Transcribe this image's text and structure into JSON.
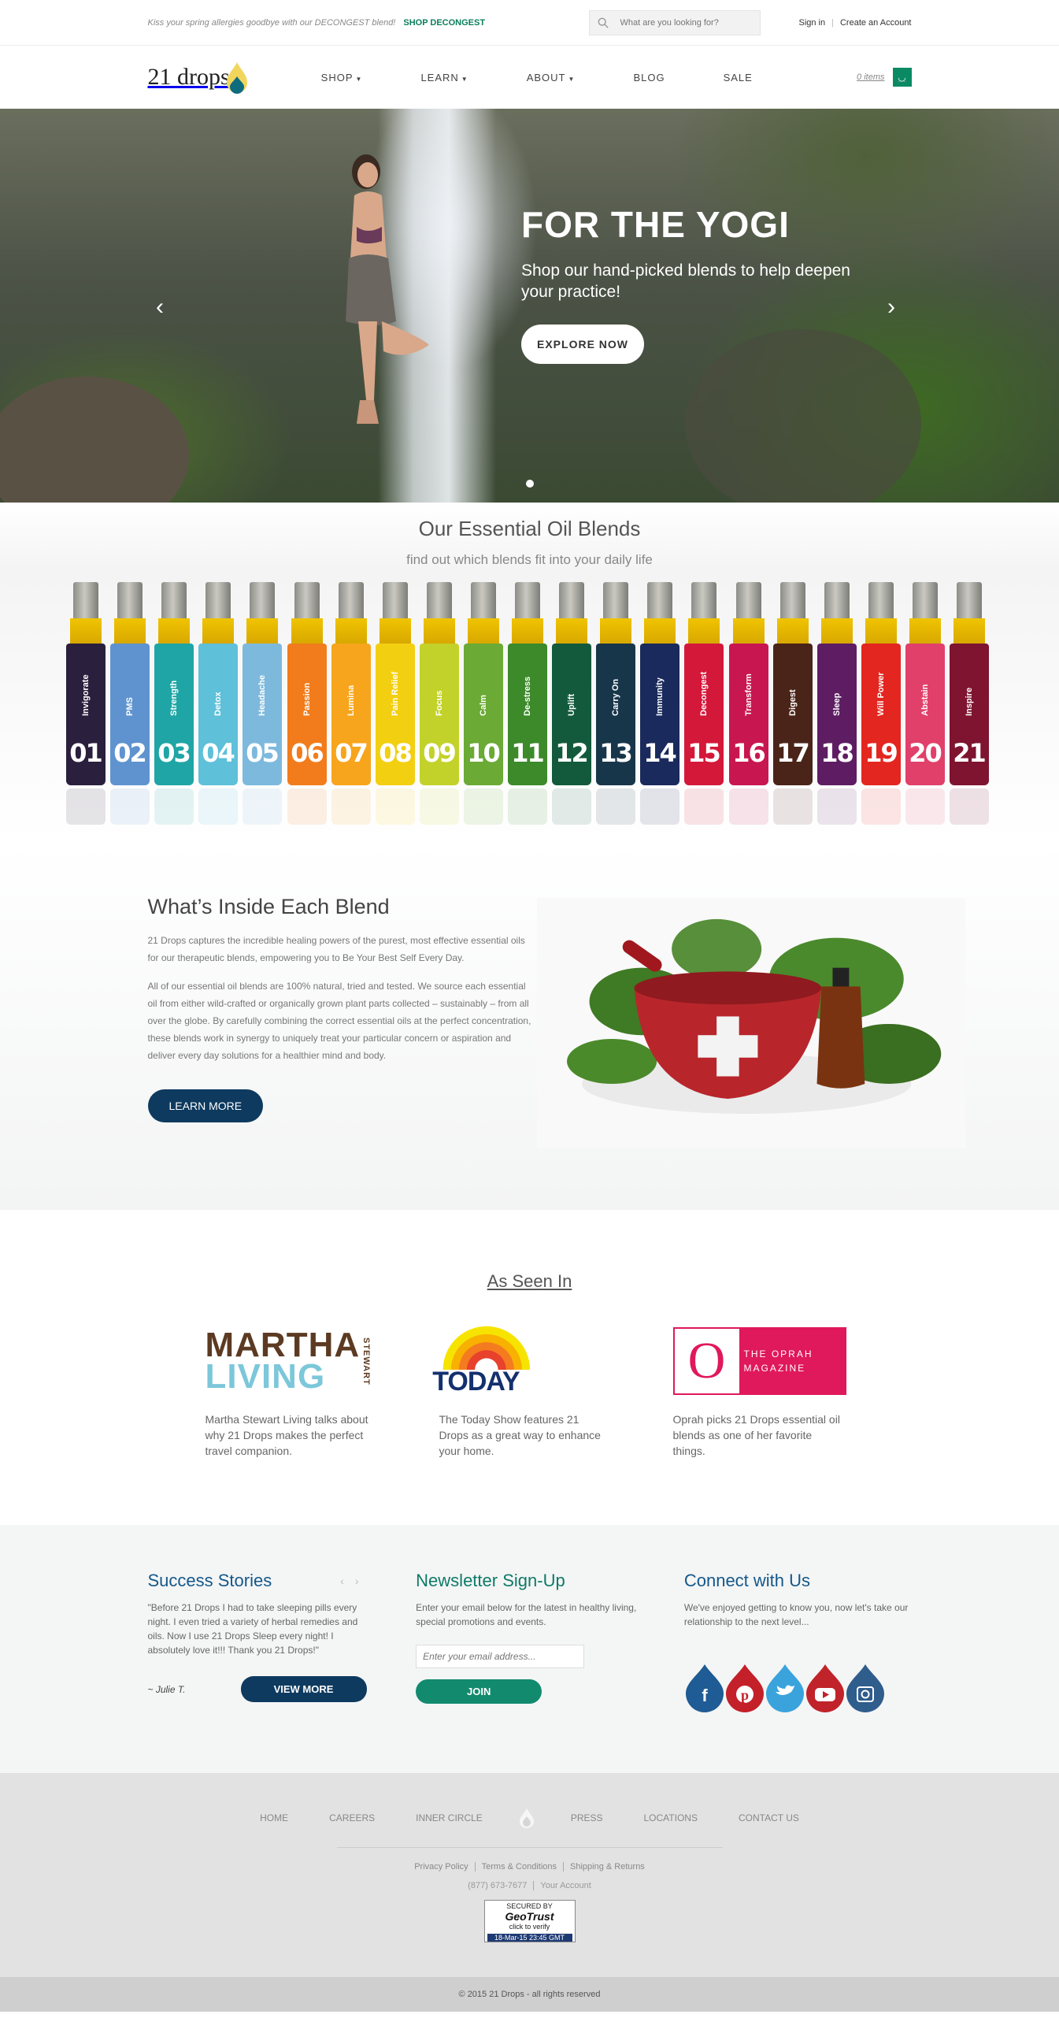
{
  "topbar": {
    "promo_text": "Kiss your spring allergies goodbye with our DECONGEST blend!",
    "promo_link": "SHOP DECONGEST",
    "search_placeholder": "What are you looking for?",
    "signin": "Sign in",
    "create_account": "Create an Account"
  },
  "nav": {
    "logo": "21 drops",
    "items": [
      "SHOP",
      "LEARN",
      "ABOUT",
      "BLOG",
      "SALE"
    ],
    "cart": "0 items"
  },
  "hero": {
    "title": "FOR THE YOGI",
    "subtitle": "Shop our hand-picked blends to help deepen your practice!",
    "button": "EXPLORE NOW"
  },
  "blends": {
    "title": "Our Essential Oil Blends",
    "subtitle": "find out which blends fit into your daily life",
    "items": [
      {
        "num": "01",
        "name": "Invigorate",
        "color": "#2a1f3d"
      },
      {
        "num": "02",
        "name": "PMS",
        "color": "#5f93cf"
      },
      {
        "num": "03",
        "name": "Strength",
        "color": "#1fa5a5"
      },
      {
        "num": "04",
        "name": "Detox",
        "color": "#5ec0d9"
      },
      {
        "num": "05",
        "name": "Headache",
        "color": "#7db9dd"
      },
      {
        "num": "06",
        "name": "Passion",
        "color": "#f27c1b"
      },
      {
        "num": "07",
        "name": "Lumina",
        "color": "#f7a51d"
      },
      {
        "num": "08",
        "name": "Pain Relief",
        "color": "#f3cf12"
      },
      {
        "num": "09",
        "name": "Focus",
        "color": "#c3d22a"
      },
      {
        "num": "10",
        "name": "Calm",
        "color": "#6aaa35"
      },
      {
        "num": "11",
        "name": "De-stress",
        "color": "#3c8a2a"
      },
      {
        "num": "12",
        "name": "Uplift",
        "color": "#135a3c"
      },
      {
        "num": "13",
        "name": "Carry On",
        "color": "#18364a"
      },
      {
        "num": "14",
        "name": "Immunity",
        "color": "#1a2a5c"
      },
      {
        "num": "15",
        "name": "Decongest",
        "color": "#d4183a"
      },
      {
        "num": "16",
        "name": "Transform",
        "color": "#c81650"
      },
      {
        "num": "17",
        "name": "Digest",
        "color": "#4a2418"
      },
      {
        "num": "18",
        "name": "Sleep",
        "color": "#5e1d63"
      },
      {
        "num": "19",
        "name": "Will Power",
        "color": "#e3261f"
      },
      {
        "num": "20",
        "name": "Abstain",
        "color": "#e0406a"
      },
      {
        "num": "21",
        "name": "Inspire",
        "color": "#7e1430"
      }
    ]
  },
  "inside": {
    "title": "What’s Inside Each Blend",
    "p1": "21 Drops captures the incredible healing powers of the purest, most effective essential oils for our therapeutic blends, empowering you to Be Your Best Self Every Day.",
    "p2": "All of our essential oil blends are 100% natural, tried and tested. We source each essential oil from either wild-crafted or organically grown plant parts collected – sustainably – from all over the globe. By carefully combining the correct essential oils at the perfect concentration, these blends work in synergy to uniquely treat your particular concern or aspiration and deliver every day solutions for a healthier mind and body.",
    "button": "LEARN MORE"
  },
  "seen": {
    "title": "As Seen In",
    "martha_1": "MARTHA",
    "martha_2": "LIVING",
    "martha_side": "STEWART",
    "today": "TODAY",
    "oprah_o": "O",
    "oprah_1": "THE OPRAH",
    "oprah_2": "MAGAZINE",
    "captions": [
      "Martha Stewart Living talks about why 21 Drops makes the perfect travel companion.",
      "The Today Show features 21 Drops as a great way to enhance your home.",
      "Oprah picks 21 Drops essential oil blends as one of her favorite things."
    ]
  },
  "stories": {
    "title": "Success Stories",
    "quote": "\"Before 21 Drops I had to take sleeping pills every night. I even tried a variety of herbal remedies and oils. Now I use 21 Drops Sleep every night! I absolutely love it!!! Thank you 21 Drops!\"",
    "author": "~ Julie T.",
    "button": "VIEW MORE"
  },
  "newsletter": {
    "title": "Newsletter Sign-Up",
    "text": "Enter your email below for the latest in healthy living, special promotions and events.",
    "placeholder": "Enter your email address...",
    "button": "JOIN"
  },
  "connect": {
    "title": "Connect with Us",
    "text": "We've enjoyed getting to know you, now let's take our relationship to the next level...",
    "colors": {
      "facebook": "#1f5b94",
      "pinterest": "#c3202a",
      "twitter": "#3aa3dc",
      "youtube": "#c0232a",
      "instagram": "#2f5d8c"
    }
  },
  "footer": {
    "nav_left": [
      "HOME",
      "CAREERS",
      "INNER CIRCLE"
    ],
    "nav_right": [
      "PRESS",
      "LOCATIONS",
      "CONTACT US"
    ],
    "links": [
      "Privacy Policy",
      "Terms & Conditions",
      "Shipping & Returns"
    ],
    "phone": "(877) 673-7677",
    "account": "Your Account",
    "geotrust_top": "SECURED BY",
    "geotrust_brand": "GeoTrust",
    "geotrust_sub": "click to verify",
    "geotrust_date": "18-Mar-15 23:45 GMT",
    "copyright": "© 2015 21 Drops - all rights reserved"
  }
}
